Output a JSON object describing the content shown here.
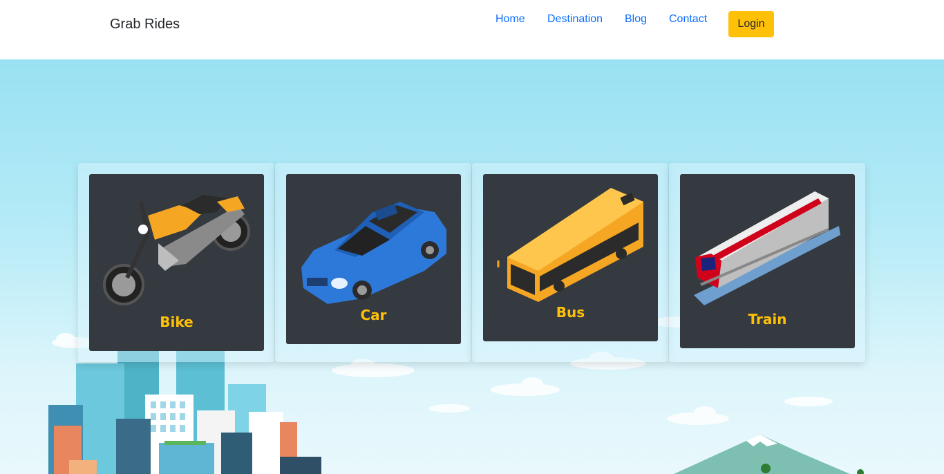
{
  "header": {
    "brand": "Grab Rides",
    "nav": [
      {
        "label": "Home"
      },
      {
        "label": "Destination"
      },
      {
        "label": "Blog"
      },
      {
        "label": "Contact"
      }
    ],
    "login_label": "Login"
  },
  "vehicles": [
    {
      "name": "Bike",
      "icon": "motorcycle-icon"
    },
    {
      "name": "Car",
      "icon": "car-icon"
    },
    {
      "name": "Bus",
      "icon": "bus-icon"
    },
    {
      "name": "Train",
      "icon": "train-icon"
    }
  ],
  "colors": {
    "accent": "#ffc107",
    "link": "#0d6efd",
    "card": "#343a40",
    "sky": "#99e1f3"
  }
}
